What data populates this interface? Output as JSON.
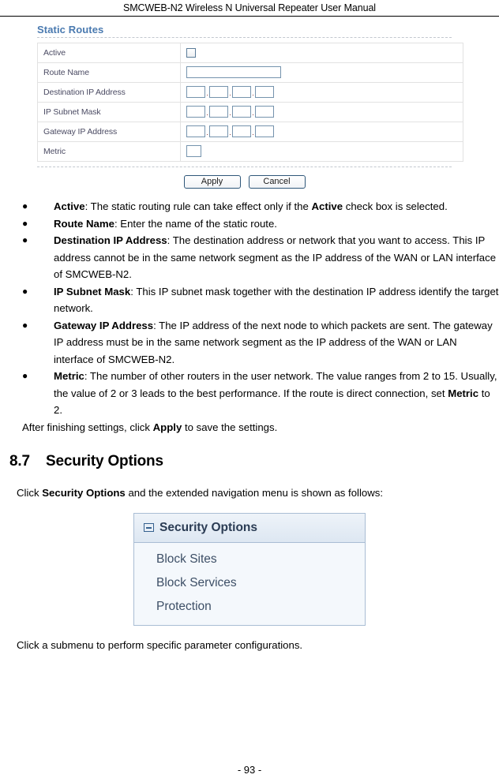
{
  "header": {
    "running_title": "SMCWEB-N2 Wireless N Universal Repeater User Manual"
  },
  "panel": {
    "title": "Static Routes",
    "rows": [
      {
        "label": "Active",
        "field": "checkbox"
      },
      {
        "label": "Route Name",
        "field": "text"
      },
      {
        "label": "Destination IP Address",
        "field": "ip"
      },
      {
        "label": "IP Subnet Mask",
        "field": "ip"
      },
      {
        "label": "Gateway IP Address",
        "field": "ip"
      },
      {
        "label": "Metric",
        "field": "small"
      }
    ],
    "labels": {
      "active": "Active",
      "route_name": "Route Name",
      "destination_ip": "Destination IP Address",
      "subnet_mask": "IP Subnet Mask",
      "gateway_ip": "Gateway IP Address",
      "metric": "Metric"
    },
    "values": {
      "active_checked": false,
      "route_name": "",
      "destination_ip": [
        "",
        "",
        "",
        ""
      ],
      "subnet_mask": [
        "",
        "",
        "",
        ""
      ],
      "gateway_ip": [
        "",
        "",
        "",
        ""
      ],
      "metric": ""
    },
    "buttons": {
      "apply": "Apply",
      "cancel": "Cancel"
    },
    "separator_dot": "."
  },
  "bullets": [
    {
      "bullet": "●",
      "term": "Active",
      "parts": [
        {
          "text": ": The static routing rule can take effect only if the ",
          "bold": false
        },
        {
          "text": "Active",
          "bold": true
        },
        {
          "text": " check box is selected.",
          "bold": false
        }
      ]
    },
    {
      "bullet": "●",
      "term": "Route Name",
      "parts": [
        {
          "text": ": Enter the name of the static route.",
          "bold": false
        }
      ]
    },
    {
      "bullet": "●",
      "term": "Destination IP Address",
      "parts": [
        {
          "text": ": The destination address or network that you want to access. This IP address cannot be in the same network segment as the IP address of the WAN or LAN interface of SMCWEB-N2.",
          "bold": false
        }
      ]
    },
    {
      "bullet": "●",
      "term": "IP Subnet Mask",
      "parts": [
        {
          "text": ": This IP subnet mask together with the destination IP address identify the target network.",
          "bold": false
        }
      ]
    },
    {
      "bullet": "●",
      "term": "Gateway IP Address",
      "parts": [
        {
          "text": ": The IP address of the next node to which packets are sent. The gateway IP address must be in the same network segment as the IP address of the WAN or LAN interface of SMCWEB-N2.",
          "bold": false
        }
      ]
    },
    {
      "bullet": "●",
      "term": "Metric",
      "parts": [
        {
          "text": ": The number of other routers in the user network. The value ranges from 2 to 15. Usually, the value of 2 or 3 leads to the best performance. If the route is direct connection, set ",
          "bold": false
        },
        {
          "text": "Metric",
          "bold": true
        },
        {
          "text": " to 2.",
          "bold": false
        }
      ]
    }
  ],
  "after_settings": {
    "lead": "After finishing settings, click ",
    "bold": "Apply",
    "tail": " to save the settings."
  },
  "section": {
    "number": "8.7",
    "title": "Security Options"
  },
  "click_security": {
    "lead": "Click ",
    "bold": "Security Options",
    "tail": " and the extended navigation menu is shown as follows:"
  },
  "navbox": {
    "header_label": "Security Options",
    "collapse_icon": "minus-icon",
    "items": [
      {
        "label": "Block Sites"
      },
      {
        "label": "Block Services"
      },
      {
        "label": "Protection"
      }
    ]
  },
  "click_submenu": "Click a submenu to perform specific parameter configurations.",
  "footer": {
    "page_number": "- 93 -"
  },
  "colors": {
    "panel_title": "#4a7ab0",
    "input_border": "#7593ad",
    "nav_border": "#a9bdd4",
    "nav_bg": "#f4f8fc",
    "nav_header_text": "#2b3c54",
    "nav_item_text": "#3d4f66"
  }
}
